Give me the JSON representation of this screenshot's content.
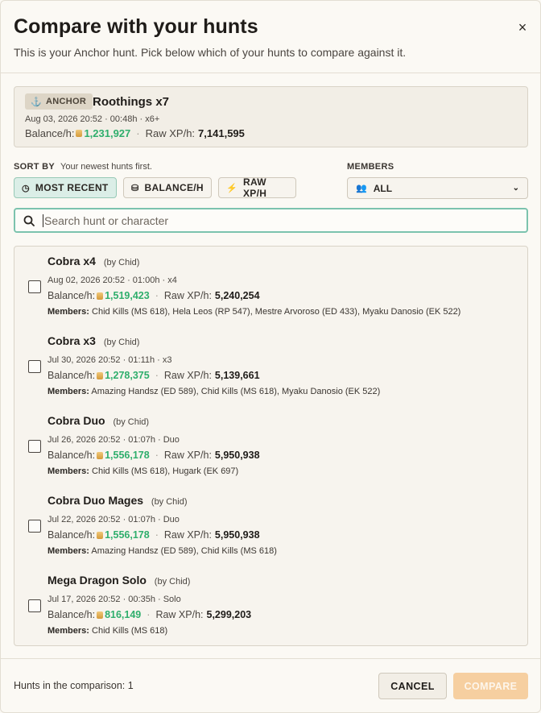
{
  "header": {
    "title": "Compare with your hunts",
    "subtitle": "This is your Anchor hunt. Pick below which of your hunts to compare against it.",
    "close_label": "×"
  },
  "anchor": {
    "badge": "ANCHOR",
    "name": "Roothings x7",
    "meta": "Aug 03, 2026 20:52 · 00:48h · x6+",
    "balance_label": "Balance/h:",
    "balance_value": "1,231,927",
    "xp_label": "Raw XP/h:",
    "xp_value": "7,141,595"
  },
  "sort": {
    "label": "SORT BY",
    "hint": "Your newest hunts first.",
    "options": [
      "MOST RECENT",
      "BALANCE/H",
      "RAW XP/H"
    ],
    "active": "MOST RECENT"
  },
  "members_filter": {
    "label": "MEMBERS",
    "selected": "ALL"
  },
  "search": {
    "placeholder": "Search hunt or character"
  },
  "hunts": [
    {
      "name": "Cobra x4",
      "by": "(by Chid)",
      "meta": "Aug 02, 2026 20:52 · 01:00h · x4",
      "balance_label": "Balance/h:",
      "balance_value": "1,519,423",
      "xp_label": "Raw XP/h:",
      "xp_value": "5,240,254",
      "members_label": "Members:",
      "members": "Chid Kills (MS 618), Hela Leos (RP 547), Mestre Arvoroso (ED 433), Myaku Danosio (EK 522)",
      "checked": false
    },
    {
      "name": "Cobra x3",
      "by": "(by Chid)",
      "meta": "Jul 30, 2026 20:52 · 01:11h · x3",
      "balance_label": "Balance/h:",
      "balance_value": "1,278,375",
      "xp_label": "Raw XP/h:",
      "xp_value": "5,139,661",
      "members_label": "Members:",
      "members": "Amazing Handsz (ED 589), Chid Kills (MS 618), Myaku Danosio (EK 522)",
      "checked": false
    },
    {
      "name": "Cobra Duo",
      "by": "(by Chid)",
      "meta": "Jul 26, 2026 20:52 · 01:07h · Duo",
      "balance_label": "Balance/h:",
      "balance_value": "1,556,178",
      "xp_label": "Raw XP/h:",
      "xp_value": "5,950,938",
      "members_label": "Members:",
      "members": "Chid Kills (MS 618), Hugark (EK 697)",
      "checked": false
    },
    {
      "name": "Cobra Duo Mages",
      "by": "(by Chid)",
      "meta": "Jul 22, 2026 20:52 · 01:07h · Duo",
      "balance_label": "Balance/h:",
      "balance_value": "1,556,178",
      "xp_label": "Raw XP/h:",
      "xp_value": "5,950,938",
      "members_label": "Members:",
      "members": "Amazing Handsz (ED 589), Chid Kills (MS 618)",
      "checked": false
    },
    {
      "name": "Mega Dragon Solo",
      "by": "(by Chid)",
      "meta": "Jul 17, 2026 20:52 · 00:35h · Solo",
      "balance_label": "Balance/h:",
      "balance_value": "816,149",
      "xp_label": "Raw XP/h:",
      "xp_value": "5,299,203",
      "members_label": "Members:",
      "members": "Chid Kills (MS 618)",
      "checked": false
    }
  ],
  "footer": {
    "count_text": "Hunts in the comparison: 1",
    "cancel_label": "CANCEL",
    "compare_label": "COMPARE"
  },
  "colors": {
    "accent_green": "#2fae6c",
    "active_sort_bg": "#dbeee7",
    "compare_disabled_bg": "#f6cfa0",
    "search_focus_border": "#7cc3ae"
  }
}
